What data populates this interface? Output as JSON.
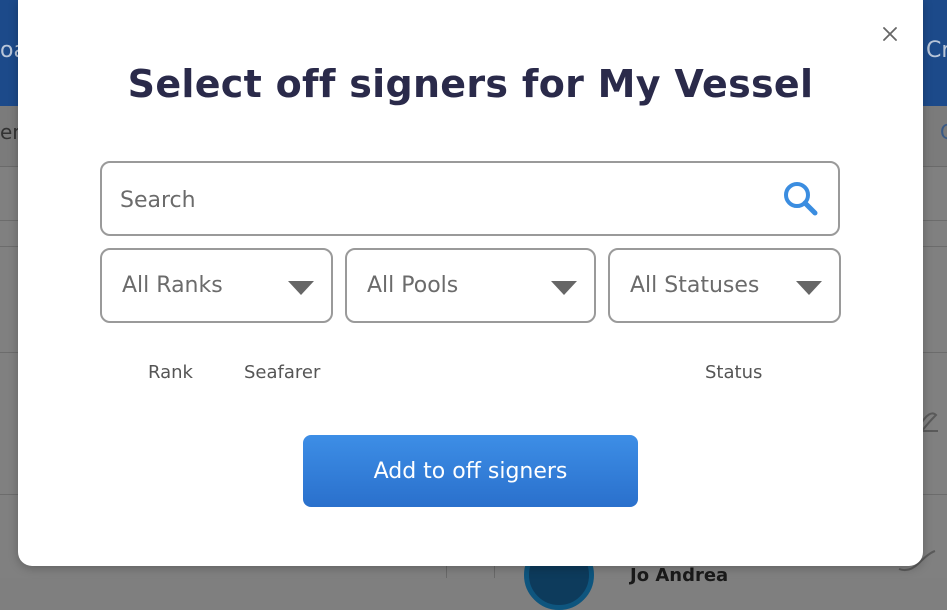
{
  "background": {
    "topbar_left_fragment": "oa",
    "topbar_right_fragment": "Cr",
    "subbar_left_fragment": "en",
    "subbar_right_fragment": "C",
    "row_person_name": "Jo Andrea"
  },
  "modal": {
    "title": "Select off signers for My Vessel",
    "close_icon": "close-icon",
    "search": {
      "placeholder": "Search",
      "value": "",
      "icon": "search-icon",
      "icon_color": "#3b8de0"
    },
    "filters": {
      "rank": "All Ranks",
      "pool": "All Pools",
      "status": "All Statuses"
    },
    "columns": [
      "Rank",
      "Seafarer",
      "Status"
    ],
    "add_button_label": "Add to off signers",
    "accent_color": "#2f7bd8"
  }
}
